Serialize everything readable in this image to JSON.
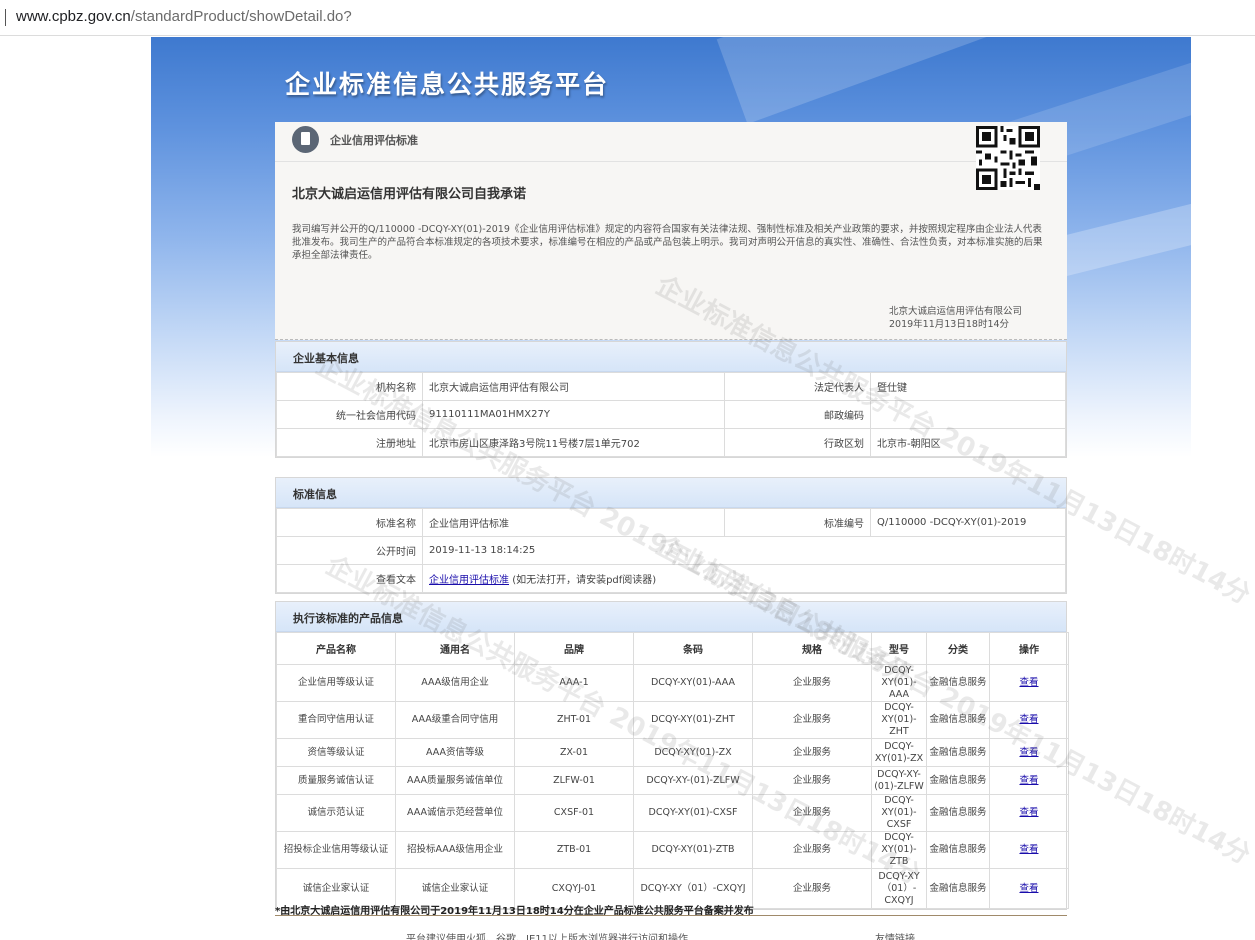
{
  "browser": {
    "url_host": "www.cpbz.gov.cn",
    "url_path": "/standardProduct/showDetail.do?"
  },
  "banner": {
    "title": "企业标准信息公共服务平台"
  },
  "card": {
    "category": "企业信用评估标准",
    "commit_title": "北京大诚启运信用评估有限公司自我承诺",
    "commit_body": "我司编写并公开的Q/110000 -DCQY-XY(01)-2019《企业信用评估标准》规定的内容符合国家有关法律法规、强制性标准及相关产业政策的要求，并按照规定程序由企业法人代表批准发布。我司生产的产品符合本标准规定的各项技术要求，标准编号在相应的产品或产品包装上明示。我司对声明公开信息的真实性、准确性、合法性负责，对本标准实施的后果承担全部法律责任。",
    "signer": "北京大诚启运信用评估有限公司",
    "sign_date": "2019年11月13日18时14分"
  },
  "basic": {
    "title": "企业基本信息",
    "org_label": "机构名称",
    "org_value": "北京大诚启运信用评估有限公司",
    "rep_label": "法定代表人",
    "rep_value": "暨仕键",
    "credit_label": "统一社会信用代码",
    "credit_value": "91110111MA01HMX27Y",
    "zip_label": "邮政编码",
    "zip_value": "",
    "addr_label": "注册地址",
    "addr_value": "北京市房山区康泽路3号院11号楼7层1单元702",
    "region_label": "行政区划",
    "region_value": "北京市-朝阳区"
  },
  "standard": {
    "title": "标准信息",
    "name_label": "标准名称",
    "name_value": "企业信用评估标准",
    "code_label": "标准编号",
    "code_value": "Q/110000 -DCQY-XY(01)-2019",
    "time_label": "公开时间",
    "time_value": "2019-11-13 18:14:25",
    "text_label": "查看文本",
    "text_link": "企业信用评估标准",
    "text_hint": "(如无法打开，请安装pdf阅读器)"
  },
  "products": {
    "title": "执行该标准的产品信息",
    "headers": [
      "产品名称",
      "通用名",
      "品牌",
      "条码",
      "规格",
      "型号",
      "分类",
      "操作"
    ],
    "rows": [
      [
        "企业信用等级认证",
        "AAA级信用企业",
        "AAA-1",
        "DCQY-XY(01)-AAA",
        "企业服务",
        "DCQY-XY(01)-AAA",
        "金融信息服务",
        "查看"
      ],
      [
        "重合同守信用认证",
        "AAA级重合同守信用",
        "ZHT-01",
        "DCQY-XY(01)-ZHT",
        "企业服务",
        "DCQY-XY(01)-ZHT",
        "金融信息服务",
        "查看"
      ],
      [
        "资信等级认证",
        "AAA资信等级",
        "ZX-01",
        "DCQY-XY(01)-ZX",
        "企业服务",
        "DCQY-XY(01)-ZX",
        "金融信息服务",
        "查看"
      ],
      [
        "质量服务诚信认证",
        "AAA质量服务诚信单位",
        "ZLFW-01",
        "DCQY-XY-(01)-ZLFW",
        "企业服务",
        "DCQY-XY-(01)-ZLFW",
        "金融信息服务",
        "查看"
      ],
      [
        "诚信示范认证",
        "AAA诚信示范经营单位",
        "CXSF-01",
        "DCQY-XY(01)-CXSF",
        "企业服务",
        "DCQY-XY(01)-CXSF",
        "金融信息服务",
        "查看"
      ],
      [
        "招投标企业信用等级认证",
        "招投标AAA级信用企业",
        "ZTB-01",
        "DCQY-XY(01)-ZTB",
        "企业服务",
        "DCQY-XY(01)-ZTB",
        "金融信息服务",
        "查看"
      ],
      [
        "诚信企业家认证",
        "诚信企业家认证",
        "CXQYJ-01",
        "DCQY-XY（01）-CXQYJ",
        "企业服务",
        "DCQY-XY（01）-CXQYJ",
        "金融信息服务",
        "查看"
      ]
    ]
  },
  "footer": {
    "note": "*由北京大诚启运信用评估有限公司于2019年11月13日18时14分在企业产品标准公共服务平台备案并发布",
    "links": "平台建议使用火狐、谷歌、IE11以上版本浏览器进行访问和操作",
    "links2": "友情链接"
  },
  "watermark_text": "企业标准信息公共服务平台 2019年11月13日18时14分"
}
